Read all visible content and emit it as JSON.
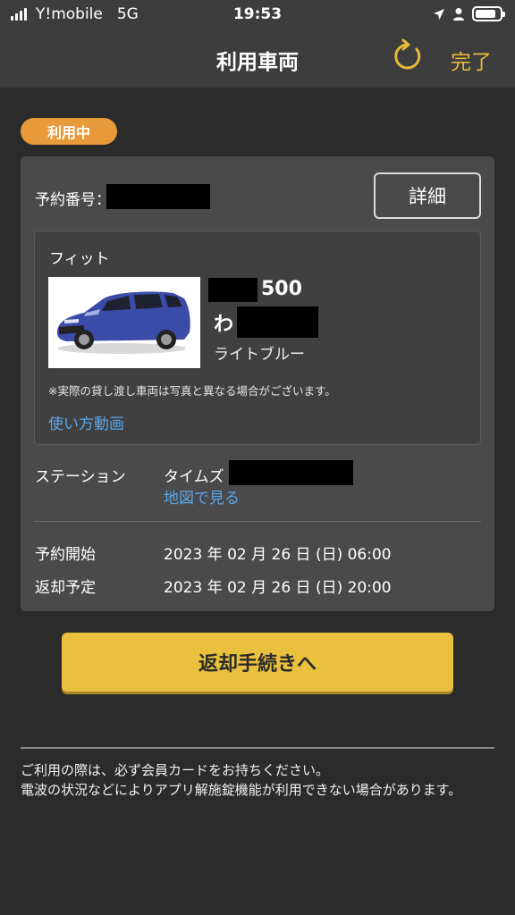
{
  "status_bar": {
    "carrier": "Y!mobile",
    "network": "5G",
    "time": "19:53"
  },
  "nav": {
    "title": "利用車両",
    "done_label": "完了",
    "refresh_icon": "refresh-icon"
  },
  "badge": {
    "label": "利用中"
  },
  "reservation": {
    "number_label": "予約番号：",
    "detail_button": "詳細"
  },
  "car": {
    "name": "フィット",
    "plate_number": "500",
    "plate_kana": "わ",
    "color_name": "ライトブルー",
    "note": "※実際の貸し渡し車両は写真と異なる場合がございます。",
    "video_link": "使い方動画"
  },
  "station": {
    "label": "ステーション",
    "name_prefix": "タイムズ",
    "map_link": "地図で見る"
  },
  "schedule": {
    "start_label": "予約開始",
    "start_value": "2023 年 02 月 26 日 (日) 06:00",
    "end_label": "返却予定",
    "end_value": "2023 年 02 月 26 日 (日) 20:00"
  },
  "return_button": "返却手続きへ",
  "footer": {
    "line1": "ご利用の際は、必ず会員カードをお持ちください。",
    "line2": "電波の状況などによりアプリ解施錠機能が利用できない場合があります。"
  },
  "colors": {
    "accent": "#e8b93a",
    "badge": "#e89a3a",
    "link": "#5aa6e8",
    "button": "#e9c13e"
  }
}
